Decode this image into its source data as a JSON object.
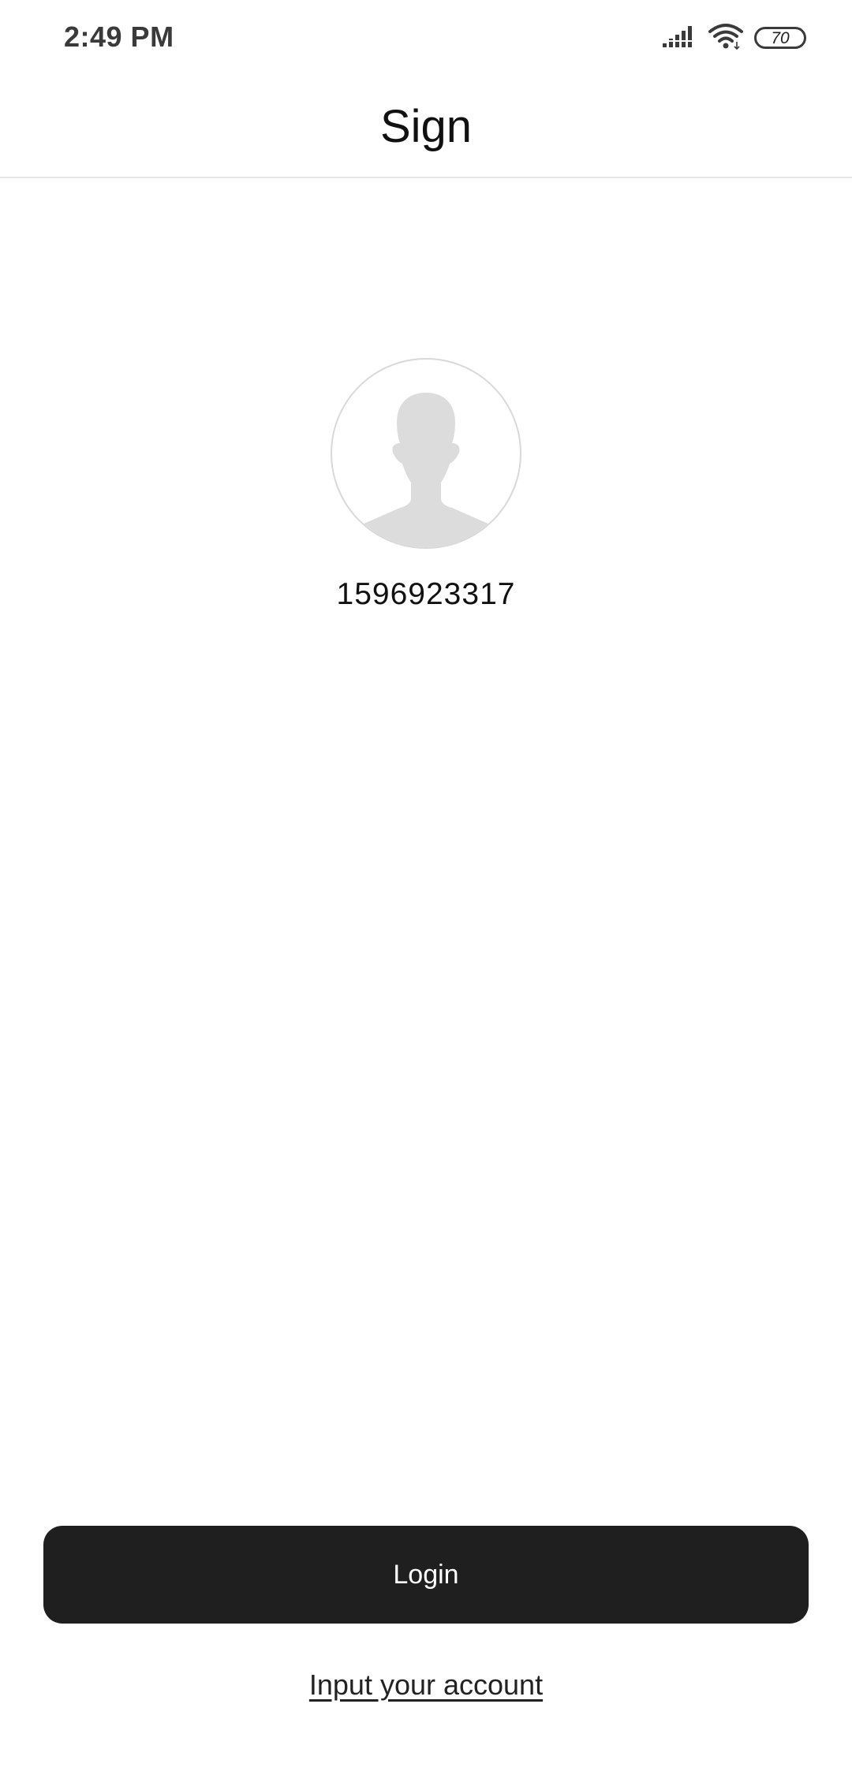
{
  "status_bar": {
    "time": "2:49 PM",
    "battery": "70",
    "icons": [
      "signal-icon",
      "wifi-icon",
      "battery-icon"
    ]
  },
  "header": {
    "title": "Sign"
  },
  "profile": {
    "avatar_icon": "default-avatar-icon",
    "account_id": "1596923317"
  },
  "actions": {
    "login_label": "Login",
    "input_account_label": "Input your account"
  },
  "colors": {
    "button_bg": "#1f1f1f",
    "button_text": "#ffffff",
    "avatar_silhouette": "#dcdcdc"
  }
}
